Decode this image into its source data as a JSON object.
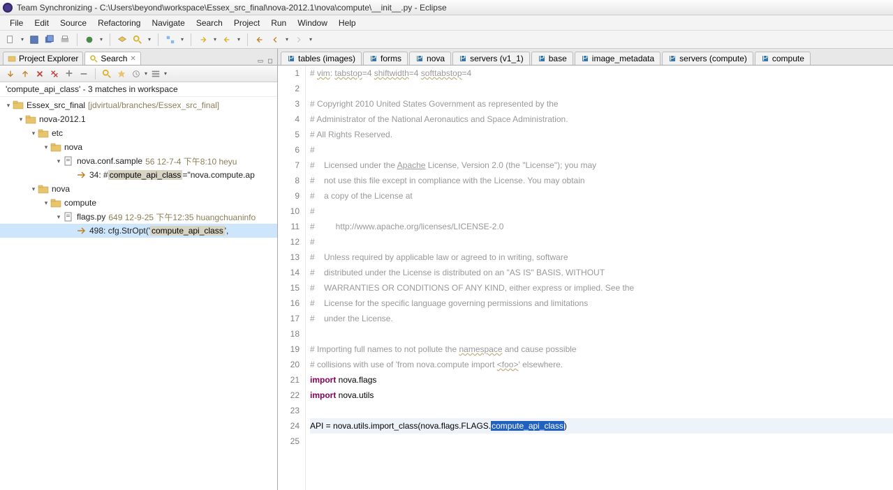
{
  "titlebar": {
    "text": "Team Synchronizing - C:\\Users\\beyond\\workspace\\Essex_src_final\\nova-2012.1\\nova\\compute\\__init__.py - Eclipse"
  },
  "menubar": [
    "File",
    "Edit",
    "Source",
    "Refactoring",
    "Navigate",
    "Search",
    "Project",
    "Run",
    "Window",
    "Help"
  ],
  "left_tabs": [
    {
      "label": "Project Explorer",
      "active": false
    },
    {
      "label": "Search",
      "active": true
    }
  ],
  "search_header": "'compute_api_class' - 3 matches in workspace",
  "tree": [
    {
      "indent": 0,
      "exp": "▾",
      "icon": "project",
      "label": "Essex_src_final",
      "meta": "[jdvirtual/branches/Essex_src_final]"
    },
    {
      "indent": 1,
      "exp": "▾",
      "icon": "folder",
      "label": "nova-2012.1"
    },
    {
      "indent": 2,
      "exp": "▾",
      "icon": "folder",
      "label": "etc"
    },
    {
      "indent": 3,
      "exp": "▾",
      "icon": "folder",
      "label": "nova"
    },
    {
      "indent": 4,
      "exp": "▾",
      "icon": "file",
      "label": "nova.conf.sample",
      "meta": "56  12-7-4 下午8:10  heyu"
    },
    {
      "indent": 5,
      "exp": "",
      "icon": "match",
      "prefix": "34: # ",
      "highlight": "compute_api_class",
      "suffix": "=\"nova.compute.ap"
    },
    {
      "indent": 2,
      "exp": "▾",
      "icon": "folder",
      "label": "nova"
    },
    {
      "indent": 3,
      "exp": "▾",
      "icon": "folder",
      "label": "compute"
    },
    {
      "indent": 4,
      "exp": "▾",
      "icon": "file",
      "label": "flags.py",
      "meta": "649  12-9-25 下午12:35  huangchuaninfo"
    },
    {
      "indent": 5,
      "exp": "",
      "icon": "match",
      "prefix": "498: cfg.StrOpt('",
      "highlight": "compute_api_class",
      "suffix": "',",
      "selected": true
    }
  ],
  "editor_tabs": [
    "tables (images)",
    "forms",
    "nova",
    "servers (v1_1)",
    "base",
    "image_metadata",
    "servers (compute)",
    "compute"
  ],
  "code_lines": [
    {
      "n": 1,
      "html": "# <span class='underline'>vim</span>: <span class='underline'>tabstop</span>=4 <span class='underline'>shiftwidth</span>=4 <span class='underline'>softtabstop</span>=4"
    },
    {
      "n": 2,
      "html": ""
    },
    {
      "n": 3,
      "html": "# Copyright 2010 United States Government as represented by the"
    },
    {
      "n": 4,
      "html": "# Administrator of the National Aeronautics and Space Administration."
    },
    {
      "n": 5,
      "html": "# All Rights Reserved."
    },
    {
      "n": 6,
      "html": "#"
    },
    {
      "n": 7,
      "html": "#    Licensed under the <span class='link-underline'>Apache</span> License, Version 2.0 (the \"License\"); you may"
    },
    {
      "n": 8,
      "html": "#    not use this file except in compliance with the License. You may obtain"
    },
    {
      "n": 9,
      "html": "#    a copy of the License at"
    },
    {
      "n": 10,
      "html": "#"
    },
    {
      "n": 11,
      "html": "#         http://www.apache.org/licenses/LICENSE-2.0"
    },
    {
      "n": 12,
      "html": "#"
    },
    {
      "n": 13,
      "html": "#    Unless required by applicable law or agreed to in writing, software"
    },
    {
      "n": 14,
      "html": "#    distributed under the License is distributed on an \"AS IS\" BASIS, WITHOUT"
    },
    {
      "n": 15,
      "html": "#    WARRANTIES OR CONDITIONS OF ANY KIND, either express or implied. See the"
    },
    {
      "n": 16,
      "html": "#    License for the specific language governing permissions and limitations"
    },
    {
      "n": 17,
      "html": "#    under the License."
    },
    {
      "n": 18,
      "html": ""
    },
    {
      "n": 19,
      "html": "# Importing full names to not pollute the <span class='underline'>namespace</span> and cause possible"
    },
    {
      "n": 20,
      "html": "# collisions with use of 'from nova.compute import <span class='underline'>&lt;foo&gt;</span>' elsewhere."
    },
    {
      "n": 21,
      "html": "<span class='normal'><span class='kw'>import</span> nova.flags</span>"
    },
    {
      "n": 22,
      "html": "<span class='normal'><span class='kw'>import</span> nova.utils</span>"
    },
    {
      "n": 23,
      "html": ""
    },
    {
      "n": 24,
      "html": "<span class='normal current'>API = nova.utils.import_class(nova.flags.FLAGS.<span class='sel'>compute_api_class</span>)</span>"
    },
    {
      "n": 25,
      "html": ""
    }
  ]
}
